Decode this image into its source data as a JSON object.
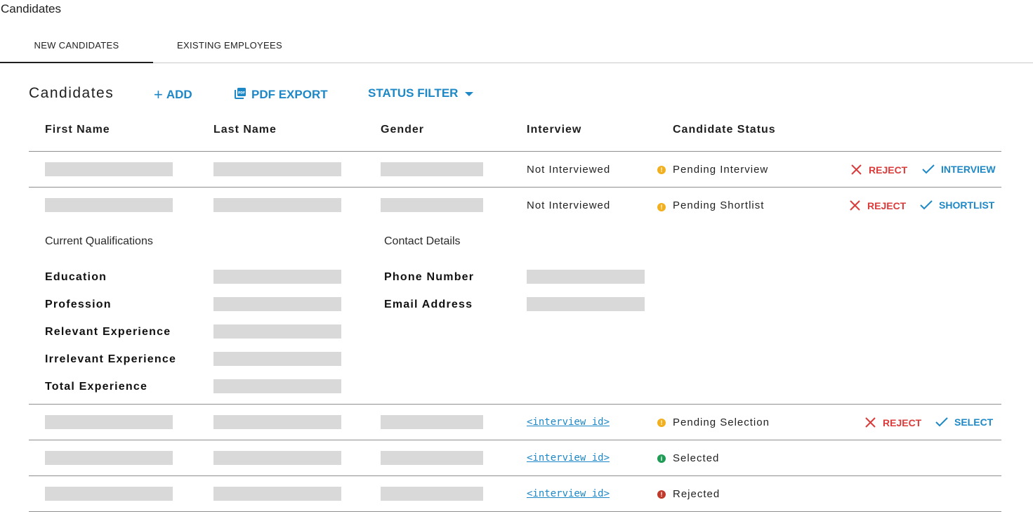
{
  "page": {
    "title": "Candidates"
  },
  "tabs": [
    {
      "label": "NEW CANDIDATES",
      "active": true
    },
    {
      "label": "EXISTING EMPLOYEES",
      "active": false
    }
  ],
  "toolbar": {
    "section_title": "Candidates",
    "add_label": "ADD",
    "add_icon": "plus-icon",
    "pdf_label": "PDF EXPORT",
    "pdf_icon": "pdf-file-icon",
    "filter_label": "STATUS FILTER",
    "filter_icon": "caret-down-icon"
  },
  "table": {
    "columns": [
      "First Name",
      "Last Name",
      "Gender",
      "Interview",
      "Candidate Status"
    ],
    "rows": [
      {
        "interview": "Not Interviewed",
        "interview_is_link": false,
        "status": "Pending Interview",
        "status_color": "#f2b01e",
        "actions": {
          "reject": "REJECT",
          "accept": "INTERVIEW"
        }
      },
      {
        "interview": "Not Interviewed",
        "interview_is_link": false,
        "status": "Pending Shortlist",
        "status_color": "#f2b01e",
        "actions": {
          "reject": "REJECT",
          "accept": "SHORTLIST"
        }
      },
      {
        "interview": "<interview id>",
        "interview_is_link": true,
        "status": "Pending Selection",
        "status_color": "#f2b01e",
        "actions": {
          "reject": "REJECT",
          "accept": "SELECT"
        }
      },
      {
        "interview": "<interview id>",
        "interview_is_link": true,
        "status": "Selected",
        "status_color": "#1e9b55",
        "actions": null
      },
      {
        "interview": "<interview id>",
        "interview_is_link": true,
        "status": "Rejected",
        "status_color": "#c0392b",
        "actions": null
      }
    ]
  },
  "details": {
    "qualifications_title": "Current Qualifications",
    "contact_title": "Contact Details",
    "qualification_labels": [
      "Education",
      "Profession",
      "Relevant Experience",
      "Irrelevant Experience",
      "Total Experience"
    ],
    "contact_labels": [
      "Phone Number",
      "Email Address"
    ]
  },
  "colors": {
    "accent": "#1e88c7",
    "reject": "#dc3b3b",
    "pending": "#f2b01e",
    "selected": "#1e9b55",
    "rejected": "#c0392b",
    "placeholder": "#d9d9d9"
  }
}
